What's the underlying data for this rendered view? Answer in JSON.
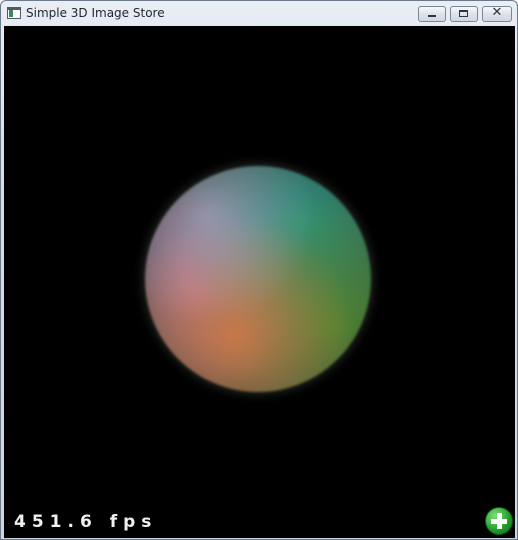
{
  "window": {
    "title": "Simple 3D Image Store"
  },
  "title_buttons": {
    "minimize": "minimize-icon",
    "maximize": "maximize-icon",
    "close_glyph": "✕"
  },
  "viewport": {
    "background": "#000000",
    "fps_text": "451.6 fps"
  },
  "add_button": {
    "icon": "plus-icon",
    "color": "#1e9a2a"
  }
}
